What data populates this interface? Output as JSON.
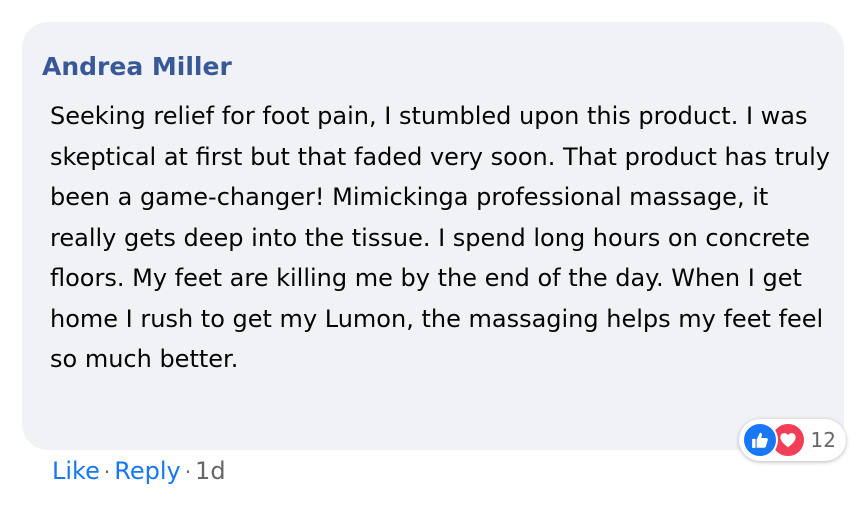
{
  "comment": {
    "author": "Andrea Miller",
    "text": "Seeking relief for foot pain, I stumbled upon this product. I was skeptical at first but that faded very soon. That product has truly been a game-changer! Mimickinga professional massage, it really gets deep into the tissue. I spend long hours on concrete floors. My feet are killing me by the end of the day. When I get home I rush to get my Lumon, the massaging helps my feet feel so much better."
  },
  "reactions": {
    "icons": [
      "like-icon",
      "love-icon"
    ],
    "count": "12",
    "colors": {
      "like": "#1877f2",
      "love": "#f33e58"
    }
  },
  "actions": {
    "like_label": "Like",
    "separator": "·",
    "reply_label": "Reply",
    "timestamp": "1d"
  },
  "colors": {
    "bubble_bg": "#f0f2f5",
    "author": "#385898",
    "link": "#1877f2",
    "muted": "#65676b"
  }
}
